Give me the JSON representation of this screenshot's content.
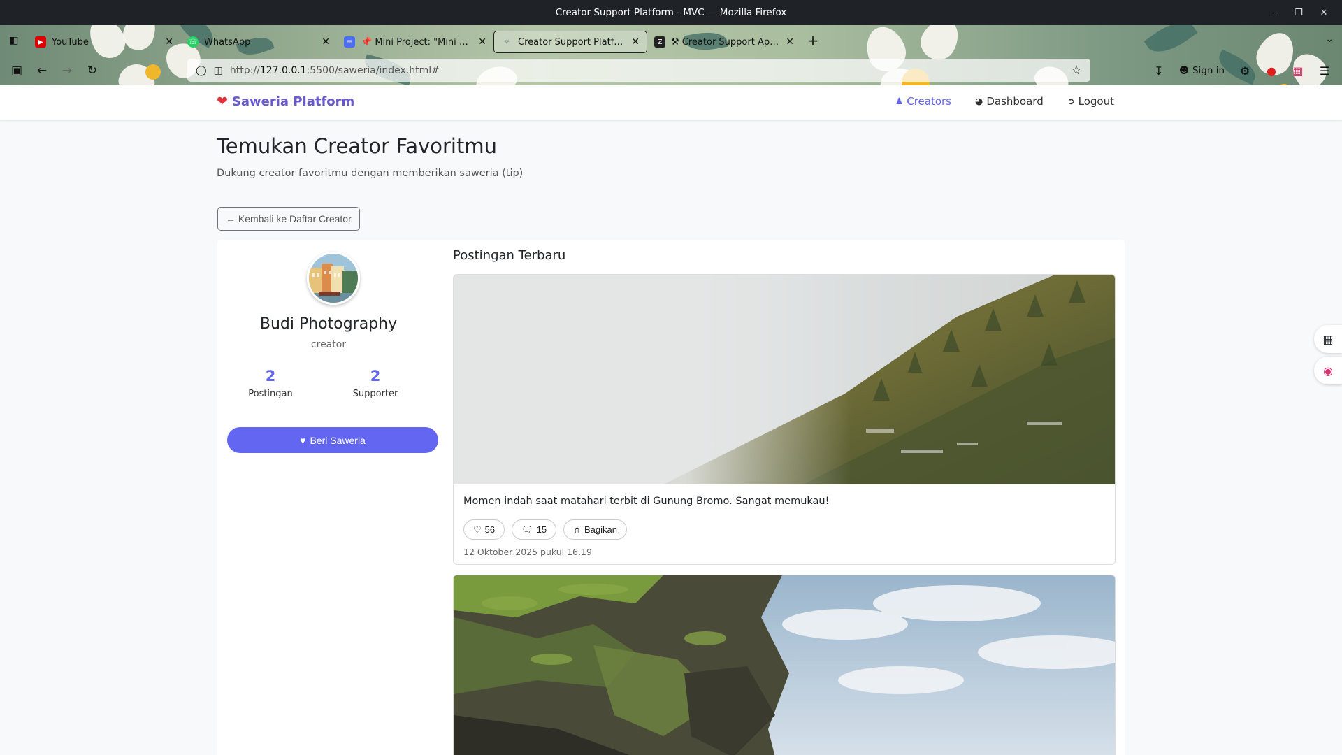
{
  "window": {
    "title": "Creator Support Platform - MVC — Mozilla Firefox"
  },
  "browser": {
    "tabs": [
      {
        "title": "YouTube",
        "favicon_color": "#e00000",
        "favicon_icon": "youtube-icon"
      },
      {
        "title": "WhatsApp",
        "favicon_color": "#25d366",
        "favicon_icon": "whatsapp-icon"
      },
      {
        "title": "📌 Mini Project: \"Mini Supp",
        "favicon_color": "#4c6ef5",
        "favicon_icon": "document-icon"
      },
      {
        "title": "Creator Support Platform - M",
        "favicon_color": "#cfcfcf",
        "favicon_icon": "globe-icon"
      },
      {
        "title": "⚒ Creator Support App | Z",
        "favicon_color": "#222222",
        "favicon_icon": "z-icon"
      }
    ],
    "url": {
      "scheme": "http://",
      "host": "127.0.0.1",
      "rest": ":5500/saweria/index.html#"
    },
    "signin_label": "Sign in"
  },
  "app": {
    "brand": "Saweria Platform",
    "nav": [
      {
        "label": "Creators",
        "icon": "people-icon"
      },
      {
        "label": "Dashboard",
        "icon": "gauge-icon"
      },
      {
        "label": "Logout",
        "icon": "logout-icon"
      }
    ]
  },
  "page": {
    "title": "Temukan Creator Favoritmu",
    "subtitle": "Dukung creator favoritmu dengan memberikan saweria (tip)",
    "back_label": "← Kembali ke Daftar Creator"
  },
  "profile": {
    "name": "Budi Photography",
    "role": "creator",
    "stats": [
      {
        "value": "2",
        "label": "Postingan"
      },
      {
        "value": "2",
        "label": "Supporter"
      }
    ],
    "tip_label": "Beri Saweria"
  },
  "feed": {
    "title": "Postingan Terbaru",
    "posts": [
      {
        "caption": "Momen indah saat matahari terbit di Gunung Bromo. Sangat memukau!",
        "likes": "56",
        "comments": "15",
        "share_label": "Bagikan",
        "date": "12 Oktober 2025 pukul 16.19"
      }
    ]
  },
  "colors": {
    "accent": "#6366f1",
    "brand": "#6a5acd",
    "heart": "#e0323c"
  }
}
